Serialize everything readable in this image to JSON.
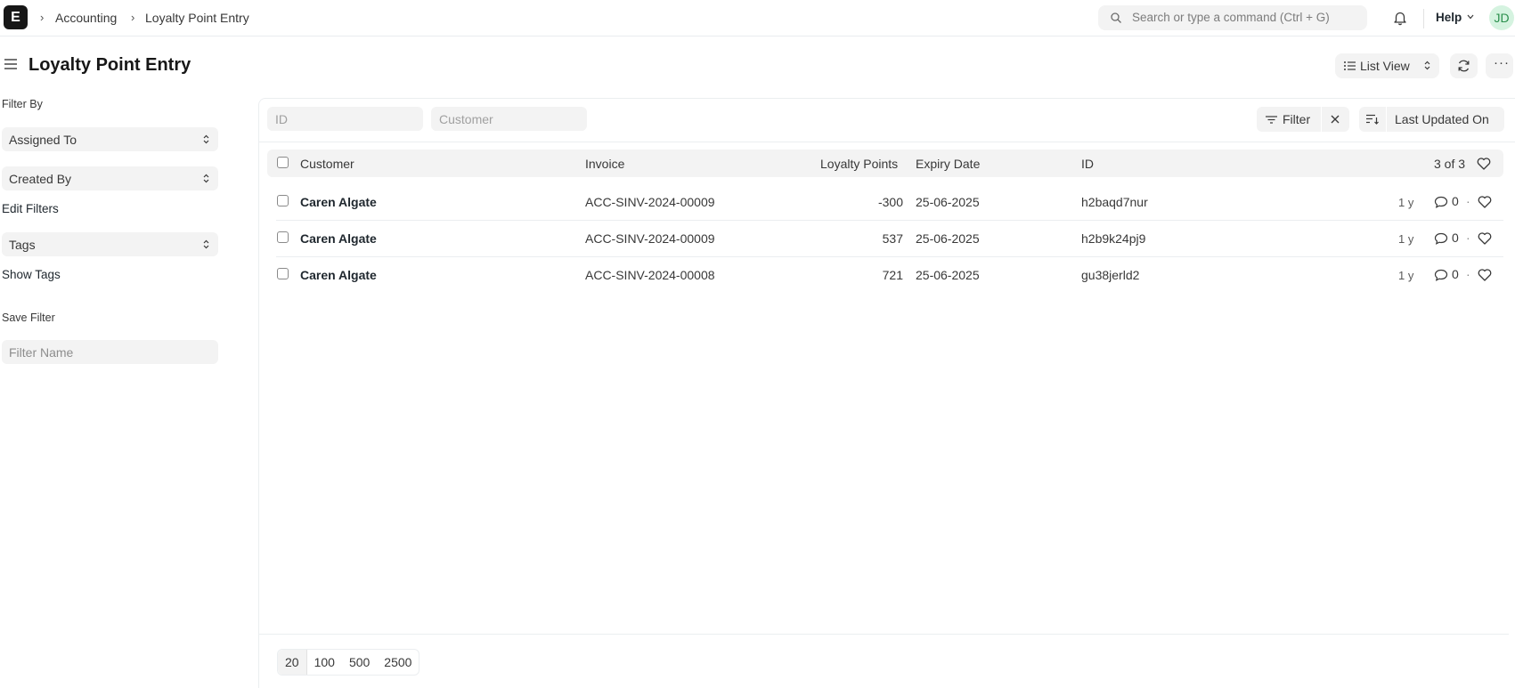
{
  "navbar": {
    "logo_letter": "E",
    "breadcrumbs": [
      "Accounting",
      "Loyalty Point Entry"
    ],
    "search_placeholder": "Search or type a command (Ctrl + G)",
    "help_label": "Help",
    "avatar_initials": "JD"
  },
  "page": {
    "title": "Loyalty Point Entry",
    "view_label": "List View"
  },
  "sidebar": {
    "filter_by_label": "Filter By",
    "assigned_to": "Assigned To",
    "created_by": "Created By",
    "edit_filters": "Edit Filters",
    "tags": "Tags",
    "show_tags": "Show Tags",
    "save_filter_label": "Save Filter",
    "filter_name_placeholder": "Filter Name"
  },
  "filters": {
    "id_placeholder": "ID",
    "customer_placeholder": "Customer",
    "filter_label": "Filter",
    "sort_label": "Last Updated On"
  },
  "list": {
    "columns": {
      "customer": "Customer",
      "invoice": "Invoice",
      "loyalty_points": "Loyalty Points",
      "expiry_date": "Expiry Date",
      "id": "ID"
    },
    "count": "3 of 3",
    "rows": [
      {
        "customer": "Caren Algate",
        "invoice": "ACC-SINV-2024-00009",
        "loyalty_points": "-300",
        "expiry_date": "25-06-2025",
        "id": "h2baqd7nur",
        "age": "1 y",
        "comments": "0"
      },
      {
        "customer": "Caren Algate",
        "invoice": "ACC-SINV-2024-00009",
        "loyalty_points": "537",
        "expiry_date": "25-06-2025",
        "id": "h2b9k24pj9",
        "age": "1 y",
        "comments": "0"
      },
      {
        "customer": "Caren Algate",
        "invoice": "ACC-SINV-2024-00008",
        "loyalty_points": "721",
        "expiry_date": "25-06-2025",
        "id": "gu38jerld2",
        "age": "1 y",
        "comments": "0"
      }
    ]
  },
  "pagination": {
    "page_sizes": [
      "20",
      "100",
      "500",
      "2500"
    ]
  },
  "colors": {
    "accent_dark": "#171717",
    "avatar_bg": "#d5f3e0",
    "avatar_fg": "#2a8f4c",
    "control_bg": "#f3f3f3"
  }
}
